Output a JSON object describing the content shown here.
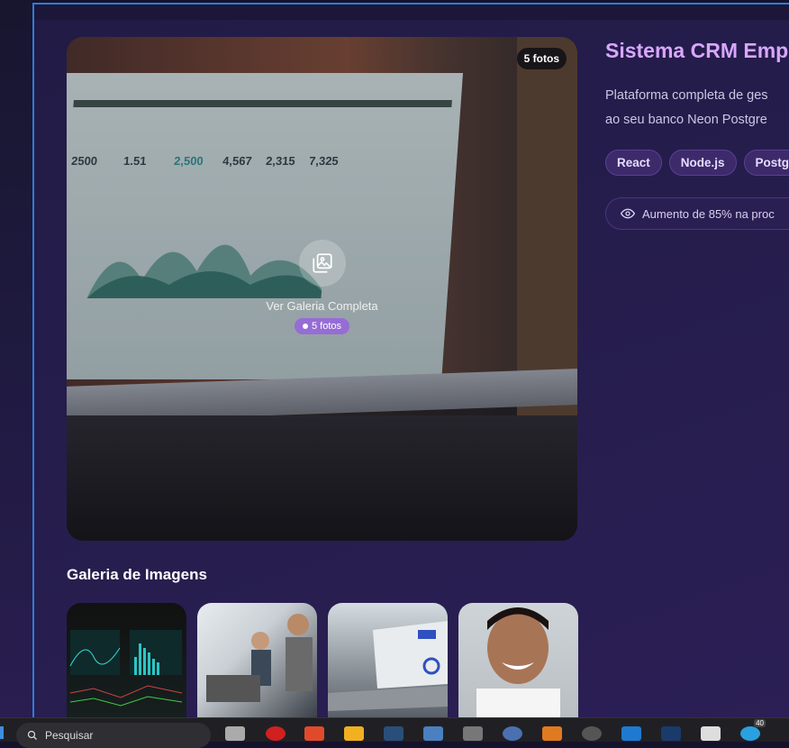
{
  "hero": {
    "photo_badge": "5 fotos",
    "gallery_label": "Ver Galeria Completa",
    "gallery_count": "5 fotos"
  },
  "project": {
    "title": "Sistema CRM Emp",
    "description_line1": "Plataforma completa de ges",
    "description_line2": "ao seu banco Neon Postgre",
    "tags": [
      "React",
      "Node.js",
      "Postg"
    ],
    "result_text": "Aumento de 85% na proc"
  },
  "gallery": {
    "heading": "Galeria de Imagens",
    "thumbs": [
      "dashboard-photo",
      "office-workers-photo",
      "laptop-analytics-photo",
      "portrait-photo"
    ]
  },
  "laptop_screen": {
    "metrics": [
      "2500",
      "1.51",
      "2,500",
      "4,567",
      "2,315",
      "7,325"
    ]
  },
  "taskbar": {
    "search_placeholder": "Pesquisar",
    "badge_count": "40"
  },
  "colors": {
    "accent_title": "#d8a6ff",
    "tag_bg": "#3c2a6a",
    "modal_border": "#2f7bd8"
  }
}
